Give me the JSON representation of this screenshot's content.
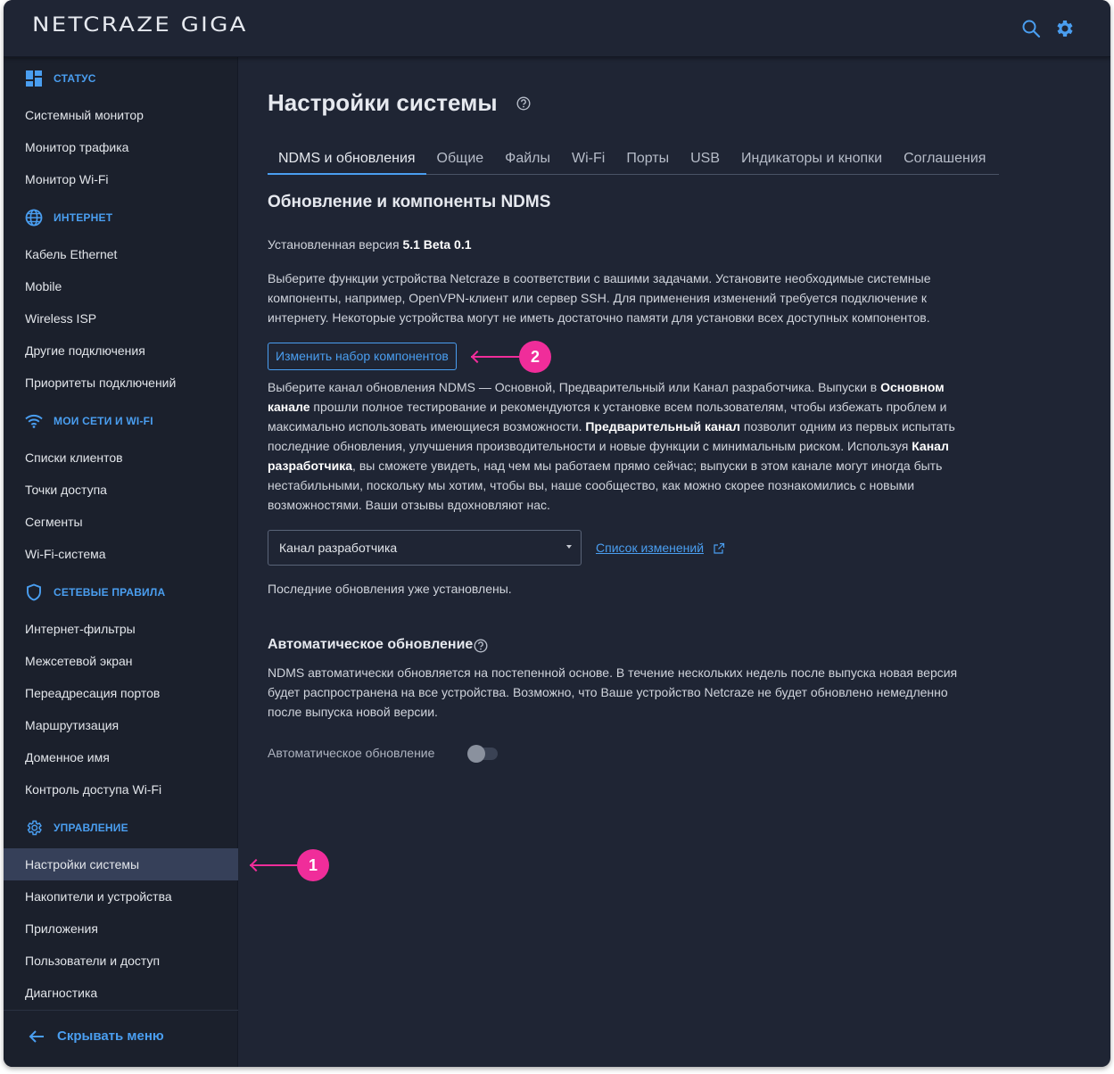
{
  "app": {
    "logo": "NETCRAZE GIGA",
    "icons": [
      "search-icon",
      "gear-icon"
    ]
  },
  "sidebar": {
    "sections": [
      {
        "title": "СТАТУС",
        "icon": "dashboard-icon",
        "items": [
          "Системный монитор",
          "Монитор трафика",
          "Монитор Wi-Fi"
        ]
      },
      {
        "title": "ИНТЕРНЕТ",
        "icon": "globe-icon",
        "items": [
          "Кабель Ethernet",
          "Mobile",
          "Wireless ISP",
          "Другие подключения",
          "Приоритеты подключений"
        ]
      },
      {
        "title": "МОИ СЕТИ И WI-FI",
        "icon": "wifi-icon",
        "items": [
          "Списки клиентов",
          "Точки доступа",
          "Сегменты",
          "Wi-Fi-система"
        ]
      },
      {
        "title": "СЕТЕВЫЕ ПРАВИЛА",
        "icon": "shield-icon",
        "items": [
          "Интернет-фильтры",
          "Межсетевой экран",
          "Переадресация портов",
          "Маршрутизация",
          "Доменное имя",
          "Контроль доступа Wi-Fi"
        ]
      },
      {
        "title": "УПРАВЛЕНИЕ",
        "icon": "gear-icon",
        "items": [
          "Настройки системы",
          "Накопители и устройства",
          "Приложения",
          "Пользователи и доступ",
          "Диагностика"
        ]
      }
    ],
    "active_item": "Настройки системы",
    "hide_menu": "Скрывать меню"
  },
  "main": {
    "title": "Настройки системы",
    "tabs": [
      "NDMS и обновления",
      "Общие",
      "Файлы",
      "Wi-Fi",
      "Порты",
      "USB",
      "Индикаторы и кнопки",
      "Соглашения"
    ],
    "active_tab": "NDMS и обновления",
    "section_title": "Обновление и компоненты NDMS",
    "installed_version_label": "Установленная версия",
    "installed_version_value": "5.1 Beta 0.1",
    "components_text": "Выберите функции устройства Netcraze в соответствии с вашими задачами. Установите необходимые системные компоненты, например, OpenVPN-клиент или сервер SSH. Для применения изменений требуется подключение к интернету. Некоторые устройства могут не иметь достаточно памяти для установки всех доступных компонентов.",
    "change_components_button": "Изменить набор компонентов",
    "channel_text": {
      "t1": "Выберите канал обновления NDMS — Основной, Предварительный или Канал разработчика. Выпуски в ",
      "b1": "Основном канале",
      "t2": " прошли полное тестирование и рекомендуются к установке всем пользователям, чтобы избежать проблем и максимально использовать имеющиеся возможности. ",
      "b2": "Предварительный канал",
      "t3": " позволит одним из первых испытать последние обновления, улучшения производительности и новые функции с минимальным риском. Используя ",
      "b3": "Канал разработчика",
      "t4": ", вы сможете увидеть, над чем мы работаем прямо сейчас; выпуски в этом канале могут иногда быть нестабильными, поскольку мы хотим, чтобы вы, наше сообщество, как можно скорее познакомились с новыми возможностями. Ваши отзывы вдохновляют нас."
    },
    "channel_select_value": "Канал разработчика",
    "changelog_link": "Список изменений",
    "updates_status": "Последние обновления уже установлены.",
    "auto_update_title": "Автоматическое обновление",
    "auto_update_text": "NDMS автоматически обновляется на постепенной основе. В течение нескольких недель после выпуска новая версия будет распространена на все устройства. Возможно, что Ваше устройство Netcraze не будет обновлено немедленно после выпуска новой версии.",
    "auto_update_toggle_label": "Автоматическое обновление",
    "auto_update_enabled": false
  },
  "callouts": [
    "1",
    "2"
  ],
  "colors": {
    "accent": "#4a9ef0",
    "callout": "#f02d9a",
    "background": "#1f2534",
    "sidebar": "#1b202c",
    "active_item": "#364059"
  }
}
